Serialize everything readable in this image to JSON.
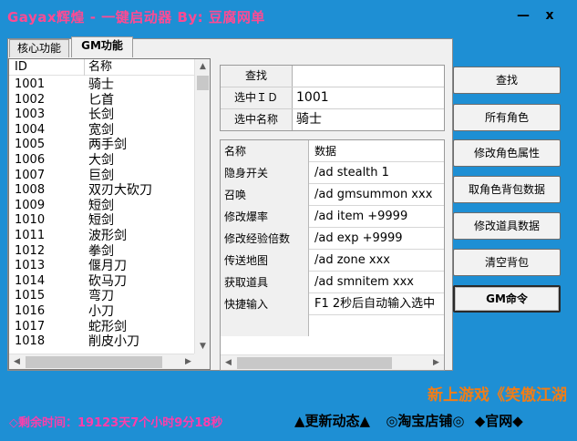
{
  "window": {
    "title": "Gayax辉煌 - 一键启动器  By: 豆腐网单",
    "minimize": "—",
    "close": "x"
  },
  "tabs": [
    {
      "label": "核心功能"
    },
    {
      "label": "GM功能"
    }
  ],
  "list": {
    "headers": [
      "ID",
      "名称"
    ],
    "rows": [
      {
        "id": "1001",
        "name": "骑士"
      },
      {
        "id": "1002",
        "name": "匕首"
      },
      {
        "id": "1003",
        "name": "长剑"
      },
      {
        "id": "1004",
        "name": "宽剑"
      },
      {
        "id": "1005",
        "name": "两手剑"
      },
      {
        "id": "1006",
        "name": "大剑"
      },
      {
        "id": "1007",
        "name": "巨剑"
      },
      {
        "id": "1008",
        "name": "双刃大砍刀"
      },
      {
        "id": "1009",
        "name": "短剑"
      },
      {
        "id": "1010",
        "name": "短剑"
      },
      {
        "id": "1011",
        "name": "波形剑"
      },
      {
        "id": "1012",
        "name": "拳剑"
      },
      {
        "id": "1013",
        "name": "偃月刀"
      },
      {
        "id": "1014",
        "name": "砍马刀"
      },
      {
        "id": "1015",
        "name": "弯刀"
      },
      {
        "id": "1016",
        "name": "小刀"
      },
      {
        "id": "1017",
        "name": "蛇形剑"
      },
      {
        "id": "1018",
        "name": "削皮小刀"
      }
    ]
  },
  "form": {
    "search_label": "查找",
    "search_value": "",
    "selected_id_label": "选中ＩＤ",
    "selected_id_value": "1001",
    "selected_name_label": "选中名称",
    "selected_name_value": "骑士"
  },
  "grid": {
    "headers": [
      "名称",
      "数据"
    ],
    "rows": [
      {
        "name": "隐身开关",
        "data": "/ad stealth 1"
      },
      {
        "name": "召唤",
        "data": "/ad gmsummon xxx"
      },
      {
        "name": "修改爆率",
        "data": "/ad item +9999"
      },
      {
        "name": "修改经验倍数",
        "data": "/ad exp +9999"
      },
      {
        "name": "传送地图",
        "data": "/ad zone xxx"
      },
      {
        "name": "获取道具",
        "data": "/ad smnitem xxx"
      },
      {
        "name": "快捷输入",
        "data": "F1 2秒后自动输入选中"
      }
    ]
  },
  "buttons": [
    {
      "label": "查找"
    },
    {
      "label": "所有角色"
    },
    {
      "label": "修改角色属性"
    },
    {
      "label": "取角色背包数据"
    },
    {
      "label": "修改道具数据"
    },
    {
      "label": "清空背包"
    },
    {
      "label": "GM命令"
    }
  ],
  "footer": {
    "marquee": "新上游戏《笑傲江湖",
    "remaining_time": "◇剩余时间：19123天7个小时9分18秒",
    "link_news": "▲更新动态▲",
    "link_shop": "◎淘宝店铺◎",
    "link_site": "◆官网◆"
  },
  "colors": {
    "window_bg": "#1e8fd4",
    "title": "#ff4a93",
    "marquee": "#f07d17",
    "remaining_time": "#ff3dab"
  }
}
